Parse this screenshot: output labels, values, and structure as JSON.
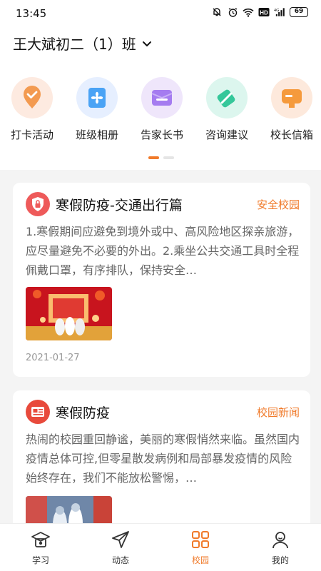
{
  "status_bar": {
    "time": "13:45",
    "battery": "69"
  },
  "class_selector": {
    "name": "王大斌初二（1）班"
  },
  "shortcuts": [
    {
      "label": "打卡活动",
      "icon": "location-check-icon",
      "bg": "#fdeae0",
      "color": "#f39a50"
    },
    {
      "label": "班级相册",
      "icon": "album-icon",
      "bg": "#e6efff",
      "color": "#4aa3f5"
    },
    {
      "label": "告家长书",
      "icon": "letter-icon",
      "bg": "#efe6fb",
      "color": "#a57cf0"
    },
    {
      "label": "咨询建议",
      "icon": "edit-note-icon",
      "bg": "#dcf6ee",
      "color": "#35c79a"
    },
    {
      "label": "校长信箱",
      "icon": "mailbox-icon",
      "bg": "#fde9dc",
      "color": "#f59a3c"
    }
  ],
  "pager": {
    "pages": 2,
    "active": 0
  },
  "articles": [
    {
      "title": "寒假防疫-交通出行篇",
      "tag": "安全校园",
      "icon": "shield-lock-icon",
      "icon_color": "#ee5a5a",
      "body": "1.寒假期间应避免到境外或中、高风险地区探亲旅游，应尽量避免不必要的外出。2.乘坐公共交通工具时全程佩戴口罩，有序排队，保持安全…",
      "date": "2021-01-27"
    },
    {
      "title": "寒假防疫",
      "tag": "校园新闻",
      "icon": "newspaper-icon",
      "icon_color": "#e84a3c",
      "body": "热闹的校园重回静谧，美丽的寒假悄然来临。虽然国内疫情总体可控,但零星散发病例和局部暴发疫情的风险始终存在，我们不能放松警惕，…"
    }
  ],
  "tabs": [
    {
      "label": "学习",
      "icon": "graduation-cap-icon",
      "active": false
    },
    {
      "label": "动态",
      "icon": "paper-plane-icon",
      "active": false
    },
    {
      "label": "校园",
      "icon": "grid-icon",
      "active": true
    },
    {
      "label": "我的",
      "icon": "user-icon",
      "active": false
    }
  ],
  "colors": {
    "accent": "#f07a2a",
    "page_bg": "#f4f4f4"
  }
}
